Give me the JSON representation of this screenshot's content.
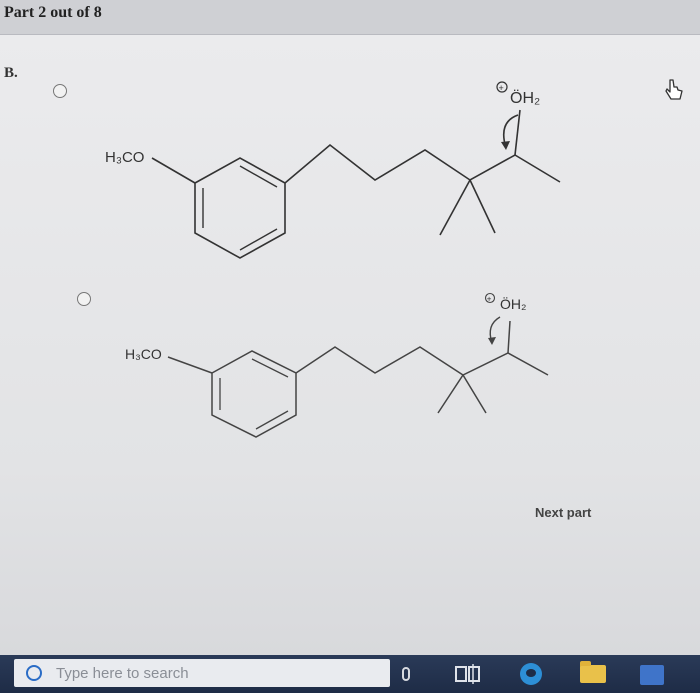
{
  "header": {
    "part_label": "Part 2 out of 8"
  },
  "question": {
    "label": "B."
  },
  "options": [
    {
      "substituent": "H₃CO",
      "reagent": "ÖH₂",
      "charge": "+"
    },
    {
      "substituent": "H₃CO",
      "reagent": "ÖH₂",
      "charge": "+"
    }
  ],
  "actions": {
    "next_part": "Next part"
  },
  "taskbar": {
    "search_placeholder": "Type here to search"
  },
  "icons": {
    "search": "search-icon",
    "mic": "microphone-icon",
    "taskview": "task-view-icon",
    "edge": "edge-browser-icon",
    "folder": "file-explorer-icon",
    "store": "store-icon",
    "cursor": "hand-pointer-icon"
  }
}
